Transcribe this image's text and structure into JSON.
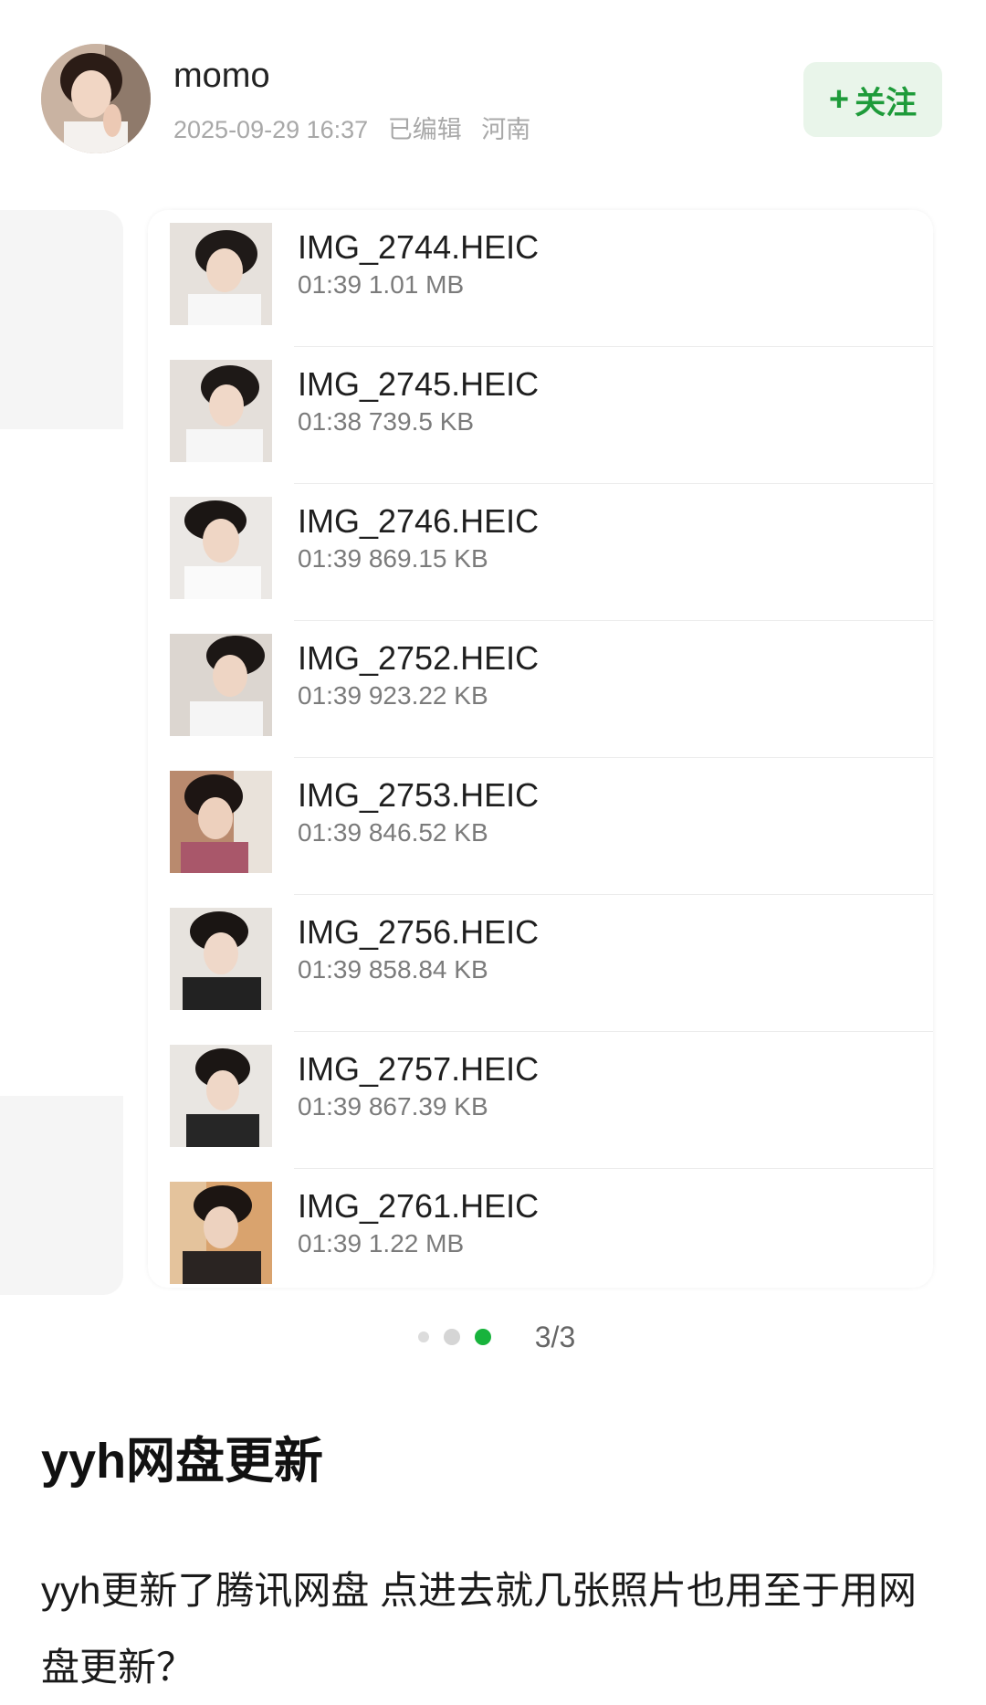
{
  "author": {
    "name": "momo",
    "timestamp": "2025-09-29 16:37",
    "edited": "已编辑",
    "location": "河南"
  },
  "follow_button": {
    "icon": "plus-icon",
    "label": "关注",
    "color": "#1e9b3a"
  },
  "files": [
    {
      "name": "IMG_2744.HEIC",
      "time": "01:39",
      "size": "1.01 MB"
    },
    {
      "name": "IMG_2745.HEIC",
      "time": "01:38",
      "size": "739.5 KB"
    },
    {
      "name": "IMG_2746.HEIC",
      "time": "01:39",
      "size": "869.15 KB"
    },
    {
      "name": "IMG_2752.HEIC",
      "time": "01:39",
      "size": "923.22 KB"
    },
    {
      "name": "IMG_2753.HEIC",
      "time": "01:39",
      "size": "846.52 KB"
    },
    {
      "name": "IMG_2756.HEIC",
      "time": "01:39",
      "size": "858.84 KB"
    },
    {
      "name": "IMG_2757.HEIC",
      "time": "01:39",
      "size": "867.39 KB"
    },
    {
      "name": "IMG_2761.HEIC",
      "time": "01:39",
      "size": "1.22 MB"
    }
  ],
  "pager": {
    "label": "3/3",
    "active_color": "#18b33c"
  },
  "post": {
    "title": "yyh网盘更新",
    "body": "yyh更新了腾讯网盘 点进去就几张照片也用至于用网盘更新？"
  }
}
